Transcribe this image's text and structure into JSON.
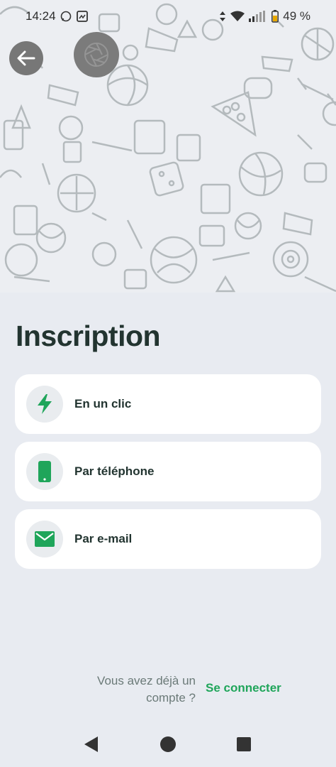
{
  "status_bar": {
    "time": "14:24",
    "battery": "49 %"
  },
  "header": {
    "back_icon": "arrow-left-icon",
    "camera_icon": "camera-aperture-icon"
  },
  "page": {
    "title": "Inscription"
  },
  "options": [
    {
      "label": "En un clic",
      "icon": "lightning-icon"
    },
    {
      "label": "Par téléphone",
      "icon": "phone-icon"
    },
    {
      "label": "Par e-mail",
      "icon": "mail-icon"
    }
  ],
  "footer": {
    "question": "Vous avez déjà un compte ?",
    "link": "Se connecter"
  },
  "colors": {
    "accent": "#1fa55a",
    "background": "#e8ebf1",
    "card": "#ffffff",
    "title": "#223430"
  }
}
